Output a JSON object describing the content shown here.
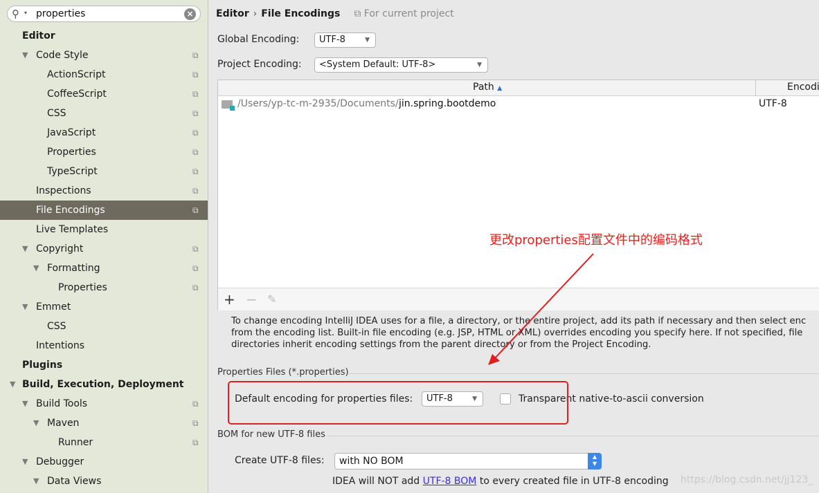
{
  "search": {
    "query": "properties"
  },
  "sidebar": {
    "items": [
      {
        "label": "Editor",
        "depth": 0,
        "bold": true
      },
      {
        "label": "Code Style",
        "depth": 1,
        "expanded": true,
        "copy": true
      },
      {
        "label": "ActionScript",
        "depth": 2,
        "copy": true
      },
      {
        "label": "CoffeeScript",
        "depth": 2,
        "copy": true
      },
      {
        "label": "CSS",
        "depth": 2,
        "copy": true
      },
      {
        "label": "JavaScript",
        "depth": 2,
        "copy": true
      },
      {
        "label": "Properties",
        "depth": 2,
        "copy": true
      },
      {
        "label": "TypeScript",
        "depth": 2,
        "copy": true
      },
      {
        "label": "Inspections",
        "depth": 1,
        "copy": true
      },
      {
        "label": "File Encodings",
        "depth": 1,
        "copy": true,
        "selected": true
      },
      {
        "label": "Live Templates",
        "depth": 1
      },
      {
        "label": "Copyright",
        "depth": 1,
        "expanded": true,
        "copy": true
      },
      {
        "label": "Formatting",
        "depth": 2,
        "expanded": true,
        "copy": true
      },
      {
        "label": "Properties",
        "depth": 3,
        "copy": true
      },
      {
        "label": "Emmet",
        "depth": 1,
        "expanded": true
      },
      {
        "label": "CSS",
        "depth": 2
      },
      {
        "label": "Intentions",
        "depth": 1
      },
      {
        "label": "Plugins",
        "depth": 0,
        "bold": true
      },
      {
        "label": "Build, Execution, Deployment",
        "depth": 0,
        "bold": true,
        "expanded": true
      },
      {
        "label": "Build Tools",
        "depth": 1,
        "expanded": true,
        "copy": true
      },
      {
        "label": "Maven",
        "depth": 2,
        "expanded": true,
        "copy": true
      },
      {
        "label": "Runner",
        "depth": 3,
        "copy": true
      },
      {
        "label": "Debugger",
        "depth": 1,
        "expanded": true
      },
      {
        "label": "Data Views",
        "depth": 2,
        "expanded": true
      }
    ]
  },
  "header": {
    "section": "Editor",
    "separator": "›",
    "page": "File Encodings",
    "scope": "For current project"
  },
  "global_encoding": {
    "label": "Global Encoding:",
    "value": "UTF-8"
  },
  "project_encoding": {
    "label": "Project Encoding:",
    "value": "<System Default: UTF-8>"
  },
  "table": {
    "col_path": "Path",
    "col_encoding": "Encodi",
    "rows": [
      {
        "path_prefix": "/Users/yp-tc-m-2935/Documents/",
        "path_name": "jin.spring.bootdemo",
        "encoding": "UTF-8"
      }
    ]
  },
  "toolbar": {
    "add": "+",
    "remove": "−",
    "edit": "✎"
  },
  "description": [
    "To change encoding IntelliJ IDEA uses for a file, a directory, or the entire project, add its path if necessary and then select enc",
    "from the encoding list. Built-in file encoding (e.g. JSP, HTML or XML) overrides encoding you specify here. If not specified, file",
    "directories inherit encoding settings from the parent directory or from the Project Encoding."
  ],
  "properties_files": {
    "section_title": "Properties Files (*.properties)",
    "default_label": "Default encoding for properties files:",
    "default_value": "UTF-8",
    "transparent_label": "Transparent native-to-ascii conversion",
    "transparent_checked": false
  },
  "bom": {
    "section_title": "BOM for new UTF-8 files",
    "create_label": "Create UTF-8 files:",
    "create_value": "with NO BOM",
    "info_before": "IDEA will NOT add ",
    "info_link": "UTF-8 BOM",
    "info_after": " to every created file in UTF-8 encoding"
  },
  "annotation": {
    "text": "更改properties配置文件中的编码格式",
    "color": "#e82020"
  },
  "watermark": "https://blog.csdn.net/jj123_",
  "colors": {
    "sidebar_bg": "#e3e8d9",
    "selected_bg": "#6e6a5d",
    "accent_red": "#e02020",
    "link": "#3d2fd0"
  }
}
